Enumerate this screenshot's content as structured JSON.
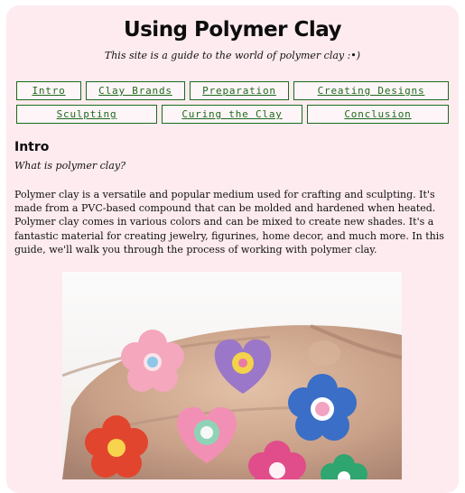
{
  "header": {
    "title": "Using Polymer Clay",
    "subtitle": "This site is a guide to the world of polymer clay :•)"
  },
  "nav": {
    "items": [
      {
        "label": "Intro"
      },
      {
        "label": "Clay Brands"
      },
      {
        "label": "Preparation"
      },
      {
        "label": "Creating Designs"
      },
      {
        "label": "Sculpting"
      },
      {
        "label": "Curing the Clay"
      },
      {
        "label": "Conclusion"
      }
    ]
  },
  "section": {
    "heading": "Intro",
    "subheading": "What is polymer clay?",
    "body": "Polymer clay is a versatile and popular medium used for crafting and sculpting. It's made from a PVC-based compound that can be molded and hardened when heated. Polymer clay comes in various colors and can be mixed to create new shades. It's a fantastic material for creating jewelry, figurines, home decor, and much more. In this guide, we'll walk you through the process of working with polymer clay."
  },
  "colors": {
    "card_background": "#fdebef",
    "nav_accent": "#1e6a1e"
  }
}
